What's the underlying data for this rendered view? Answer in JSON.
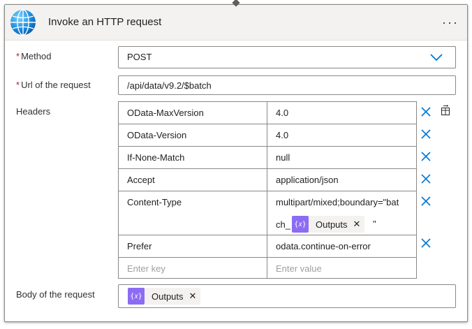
{
  "header": {
    "title": "Invoke an HTTP request",
    "more_label": "···"
  },
  "method": {
    "label": "Method",
    "required_mark": "*",
    "value": "POST"
  },
  "url": {
    "label": "Url of the request",
    "required_mark": "*",
    "value": "/api/data/v9.2/$batch"
  },
  "headers": {
    "label": "Headers",
    "rows": [
      {
        "key": "OData-MaxVersion",
        "value": "4.0"
      },
      {
        "key": "OData-Version",
        "value": "4.0"
      },
      {
        "key": "If-None-Match",
        "value": "null"
      },
      {
        "key": "Accept",
        "value": "application/json"
      },
      {
        "key": "Content-Type",
        "value_line1": "multipart/mixed;boundary=\"bat",
        "value_line2_prefix": "ch_",
        "value_token": "Outputs",
        "value_line2_suffix": "\""
      },
      {
        "key": "Prefer",
        "value": "odata.continue-on-error"
      }
    ],
    "key_placeholder": "Enter key",
    "value_placeholder": "Enter value"
  },
  "body": {
    "label": "Body of the request",
    "token": "Outputs"
  },
  "token_icon_glyph": "{𝑥}",
  "colors": {
    "accent_blue": "#0078d4",
    "token_purple": "#8c6cf2",
    "required_red": "#a4262c"
  }
}
